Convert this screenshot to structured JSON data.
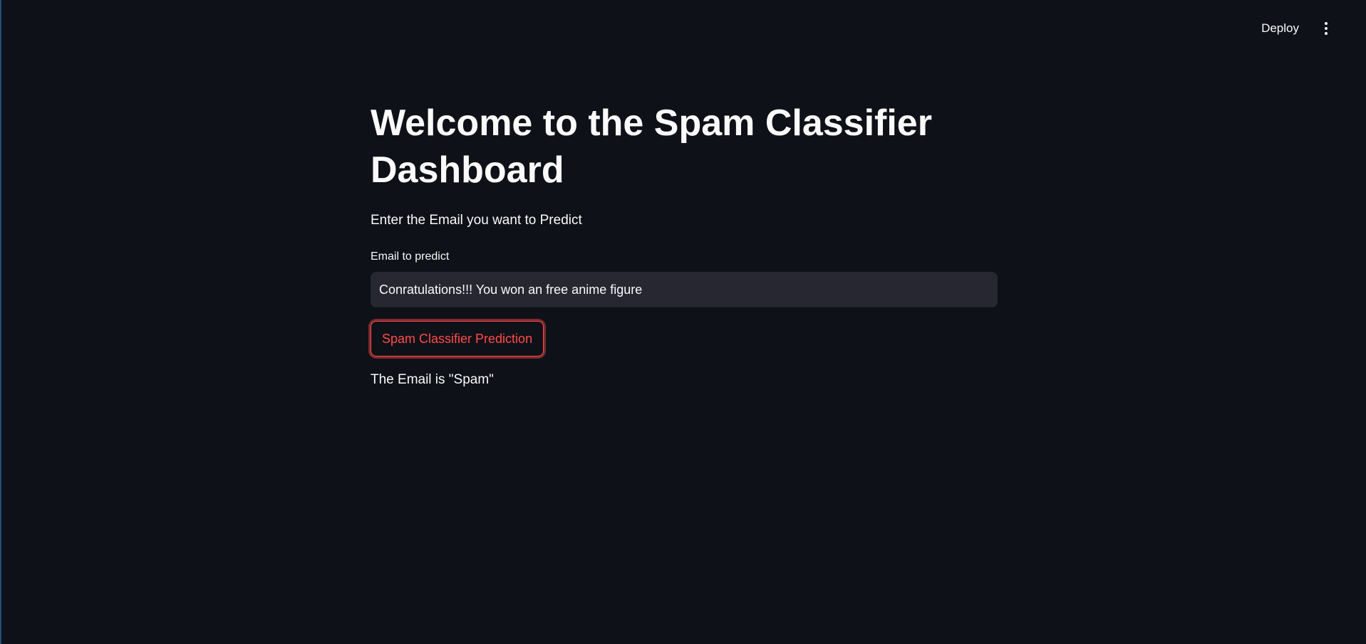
{
  "header": {
    "deploy_label": "Deploy",
    "menu_icon": "vertical-ellipsis-icon"
  },
  "main": {
    "title": "Welcome to the Spam Classifier Dashboard",
    "subtitle": "Enter the Email you want to Predict",
    "email_field": {
      "label": "Email to predict",
      "value": "Conratulations!!! You won an free anime figure"
    },
    "predict_button_label": "Spam Classifier Prediction",
    "result_text": "The Email is \"Spam\""
  },
  "colors": {
    "background": "#0e1117",
    "input_background": "#262730",
    "accent": "#ff4b4b",
    "text": "#fafafa"
  }
}
